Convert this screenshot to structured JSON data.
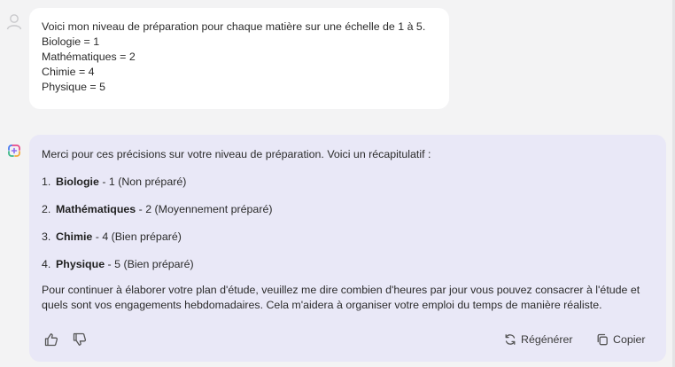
{
  "user_message": {
    "lines": [
      "Voici mon niveau de préparation pour chaque matière sur une échelle de 1 à 5.",
      "Biologie = 1",
      "Mathématiques = 2",
      "Chimie = 4",
      "Physique = 5"
    ]
  },
  "assistant_message": {
    "intro": "Merci pour ces précisions sur votre niveau de préparation. Voici un récapitulatif :",
    "items": [
      {
        "number": "1.",
        "subject": "Biologie",
        "detail": " - 1 (Non préparé)"
      },
      {
        "number": "2.",
        "subject": "Mathématiques",
        "detail": " - 2 (Moyennement préparé)"
      },
      {
        "number": "3.",
        "subject": "Chimie",
        "detail": " - 4 (Bien préparé)"
      },
      {
        "number": "4.",
        "subject": "Physique",
        "detail": " - 5 (Bien préparé)"
      }
    ],
    "closing": "Pour continuer à élaborer votre plan d'étude, veuillez me dire combien d'heures par jour vous pouvez consacrer à l'étude et quels sont vos engagements hebdomadaires. Cela m'aidera à organiser votre emploi du temps de manière réaliste."
  },
  "actions": {
    "regenerate_label": "Régénérer",
    "copy_label": "Copier"
  },
  "icons": {
    "user_avatar": "user-avatar-icon",
    "assistant_logo": "assistant-logo-icon",
    "thumbs_up": "thumbs-up-icon",
    "thumbs_down": "thumbs-down-icon",
    "regenerate": "refresh-icon",
    "copy": "copy-icon"
  },
  "colors": {
    "page_background": "#f3f3f4",
    "user_bubble": "#ffffff",
    "assistant_bubble": "#e9e8f7"
  }
}
